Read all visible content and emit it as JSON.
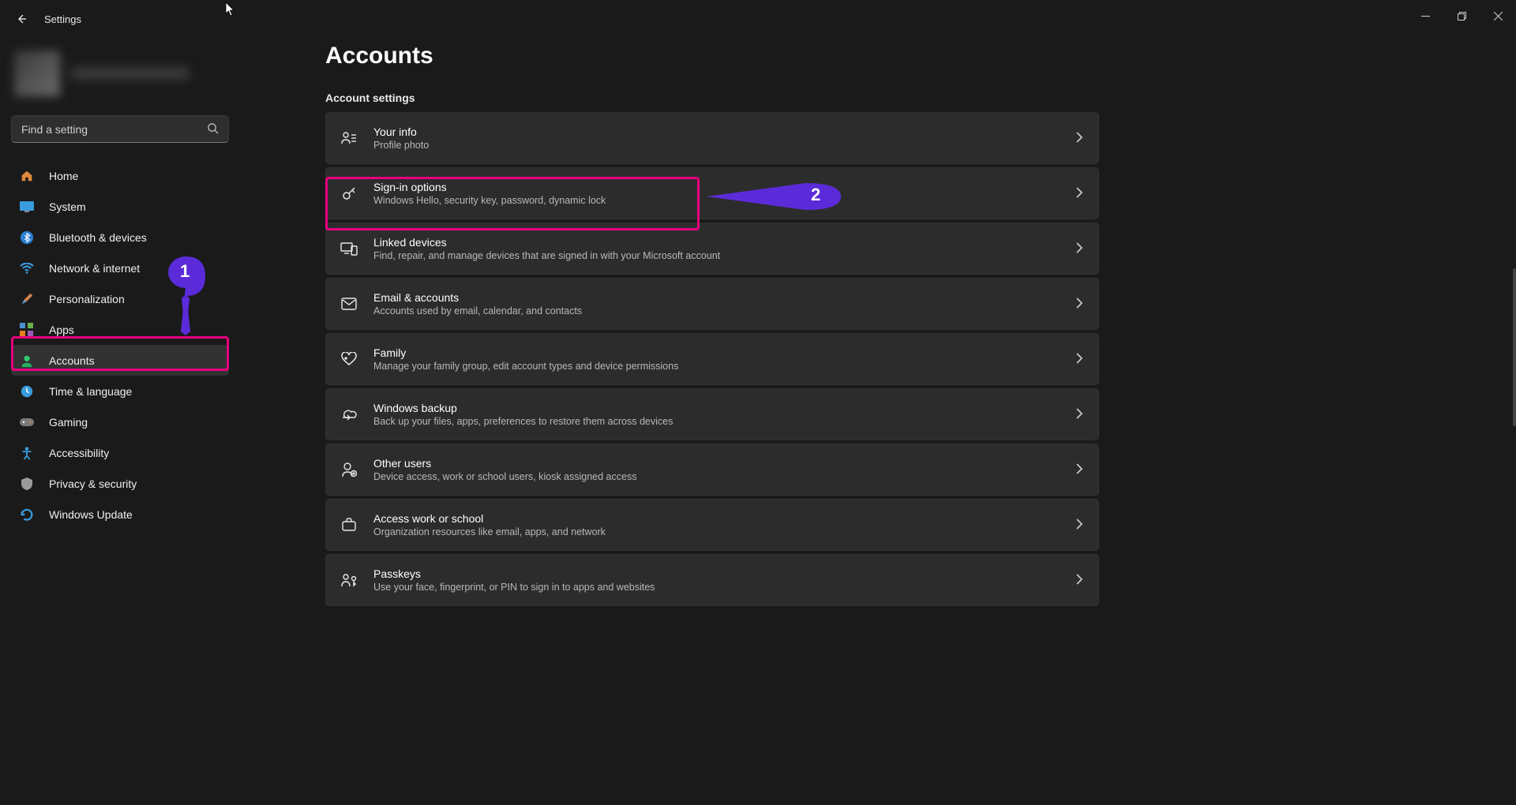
{
  "window": {
    "title": "Settings"
  },
  "search": {
    "placeholder": "Find a setting"
  },
  "nav": {
    "items": [
      {
        "label": "Home"
      },
      {
        "label": "System"
      },
      {
        "label": "Bluetooth & devices"
      },
      {
        "label": "Network & internet"
      },
      {
        "label": "Personalization"
      },
      {
        "label": "Apps"
      },
      {
        "label": "Accounts"
      },
      {
        "label": "Time & language"
      },
      {
        "label": "Gaming"
      },
      {
        "label": "Accessibility"
      },
      {
        "label": "Privacy & security"
      },
      {
        "label": "Windows Update"
      }
    ]
  },
  "page": {
    "title": "Accounts",
    "section": "Account settings"
  },
  "cards": [
    {
      "title": "Your info",
      "sub": "Profile photo"
    },
    {
      "title": "Sign-in options",
      "sub": "Windows Hello, security key, password, dynamic lock"
    },
    {
      "title": "Linked devices",
      "sub": "Find, repair, and manage devices that are signed in with your Microsoft account"
    },
    {
      "title": "Email & accounts",
      "sub": "Accounts used by email, calendar, and contacts"
    },
    {
      "title": "Family",
      "sub": "Manage your family group, edit account types and device permissions"
    },
    {
      "title": "Windows backup",
      "sub": "Back up your files, apps, preferences to restore them across devices"
    },
    {
      "title": "Other users",
      "sub": "Device access, work or school users, kiosk assigned access"
    },
    {
      "title": "Access work or school",
      "sub": "Organization resources like email, apps, and network"
    },
    {
      "title": "Passkeys",
      "sub": "Use your face, fingerprint, or PIN to sign in to apps and websites"
    }
  ],
  "annotations": {
    "one": "1",
    "two": "2"
  }
}
